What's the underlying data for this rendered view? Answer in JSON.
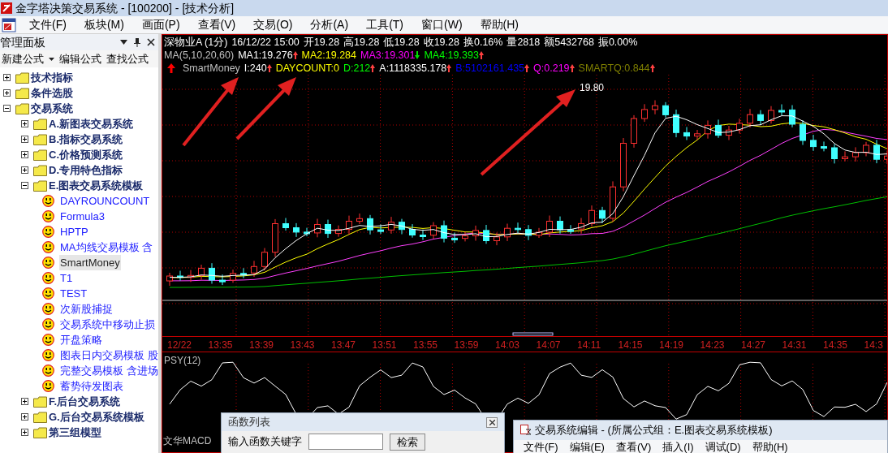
{
  "window": {
    "title": "金字塔决策交易系统 - [100200] - [技术分析]"
  },
  "menu": [
    "文件(F)",
    "板块(M)",
    "画面(P)",
    "查看(V)",
    "交易(O)",
    "分析(A)",
    "工具(T)",
    "窗口(W)",
    "帮助(H)"
  ],
  "panel": {
    "title": "管理面板",
    "toolbar": [
      "新建公式",
      "编辑公式",
      "查找公式"
    ],
    "tree": [
      {
        "label": "技术指标",
        "kind": "folder",
        "expanded": false
      },
      {
        "label": "条件选股",
        "kind": "folder",
        "expanded": false
      },
      {
        "label": "交易系统",
        "kind": "folder",
        "expanded": true,
        "children": [
          {
            "label": "A.新图表交易系统",
            "kind": "folder",
            "expanded": false
          },
          {
            "label": "B.指标交易系统",
            "kind": "folder",
            "expanded": false
          },
          {
            "label": "C.价格预测系统",
            "kind": "folder",
            "expanded": false
          },
          {
            "label": "D.专用特色指标",
            "kind": "folder",
            "expanded": false
          },
          {
            "label": "E.图表交易系统模板",
            "kind": "folder",
            "expanded": true,
            "children": [
              {
                "label": "DAYROUNCOUNT",
                "kind": "formula",
                "selected": false
              },
              {
                "label": "Formula3",
                "kind": "formula",
                "selected": false
              },
              {
                "label": "HPTP",
                "kind": "formula",
                "selected": false
              },
              {
                "label": "MA均线交易模板 含",
                "kind": "formula",
                "selected": false
              },
              {
                "label": "SmartMoney",
                "kind": "formula",
                "selected": true
              },
              {
                "label": "T1",
                "kind": "formula",
                "selected": false
              },
              {
                "label": "TEST",
                "kind": "formula",
                "selected": false
              },
              {
                "label": "次新股捕捉",
                "kind": "formula",
                "selected": false
              },
              {
                "label": "交易系统中移动止损",
                "kind": "formula",
                "selected": false
              },
              {
                "label": "开盘策略",
                "kind": "formula",
                "selected": false
              },
              {
                "label": "图表日内交易模板 股",
                "kind": "formula",
                "selected": false
              },
              {
                "label": "完整交易模板 含进场",
                "kind": "formula",
                "selected": false
              },
              {
                "label": "蓄势待发图表",
                "kind": "formula",
                "selected": false
              }
            ]
          },
          {
            "label": "F.后台交易系统",
            "kind": "folder",
            "expanded": false
          },
          {
            "label": "G.后台交易系统模板",
            "kind": "folder",
            "expanded": false
          },
          {
            "label": "第三组模型",
            "kind": "folder",
            "expanded": false
          }
        ]
      }
    ]
  },
  "chart": {
    "quote_line": [
      "深物业A (1分)",
      "16/12/22 15:00",
      "开19.28",
      "高19.28",
      "低19.28",
      "收19.28",
      "换0.16%",
      "量2818",
      "额5432768",
      "振0.00%"
    ],
    "ma_label": "MA(5,10,20,60)",
    "ma_line": [
      {
        "text": "MA1:19.276",
        "color": "#ffffff",
        "kind": "up"
      },
      {
        "text": "MA2:19.284",
        "color": "#ffff00",
        "kind": "plain"
      },
      {
        "text": "MA3:19.301",
        "color": "#ff00ff",
        "kind": "down"
      },
      {
        "text": "MA4:19.393",
        "color": "#00ff00",
        "kind": "up"
      }
    ],
    "indicator": {
      "label": "SmartMoney",
      "kind": "up"
    },
    "indicator_line": [
      {
        "text": "I:240",
        "color": "#ffffff",
        "kind": "up"
      },
      {
        "text": "DAYCOUNT:0",
        "color": "#ffff00",
        "kind": "plain"
      },
      {
        "text": "D:212",
        "color": "#00ff00",
        "kind": "up"
      },
      {
        "text": "A:1118335.178",
        "color": "#ffffff",
        "kind": "up"
      },
      {
        "text": "B:5102161.435",
        "color": "#0000ff",
        "kind": "up"
      },
      {
        "text": "Q:0.219",
        "color": "#ff00ff",
        "kind": "up"
      },
      {
        "text": "SMARTQ:0.844",
        "color": "#808000",
        "kind": "up"
      }
    ],
    "max_label": "19.80",
    "time_axis": [
      "12/22",
      "13:35",
      "13:39",
      "13:43",
      "13:47",
      "13:51",
      "13:55",
      "13:59",
      "14:03",
      "14:07",
      "14:11",
      "14:15",
      "14:19",
      "14:23",
      "14:27",
      "14:31",
      "14:35",
      "14:3"
    ],
    "indicator_title": "PSY(12)",
    "bottom_label": "文华MACD"
  },
  "function_list_window": {
    "title": "函数列表",
    "search_label": "输入函数关键字",
    "search_button": "检索"
  },
  "editor_window": {
    "title": "交易系统编辑 - (所属公式组：E.图表交易系统模板)",
    "menu": [
      "文件(F)",
      "编辑(E)",
      "查看(V)",
      "插入(I)",
      "调试(D)",
      "帮助(H)"
    ]
  }
}
